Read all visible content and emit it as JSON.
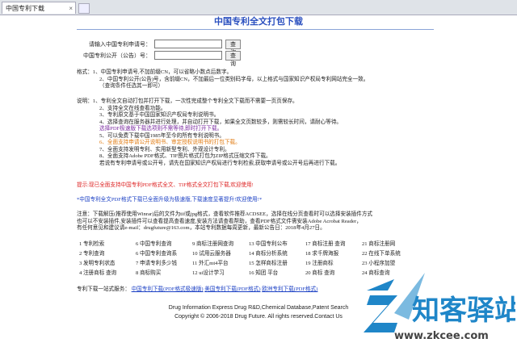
{
  "tab": {
    "label": "中国专利下载"
  },
  "title": "中国专利全文打包下载",
  "form": {
    "app_label": "请输入中国专利申请号：",
    "pub_label": "中国专利公开（公告）号：",
    "query_label": "查询",
    "query_label2": "查询"
  },
  "format_lines": [
    "格式：1、中国专利申请号,不加前缀CN，可以省略小数点后数字。",
    "2、中国专利公开(公告)号，含前缀CN，不加最后一位类别码字母，以上格式与国家知识产权局专利网站完全一致。",
    "（查询条件任选其一即可）"
  ],
  "notes_head": "说明：1、专利全文自动打包并打开下载，一次性完成整个专利全文下载而不需要一页页保存。",
  "notes": [
    {
      "text": "2、支持全文在线查看功能。",
      "color": ""
    },
    {
      "text": "3、专利原文基于中国国家知识产权局专利说明书。",
      "color": ""
    },
    {
      "text": "4、选择查询在服务器并进行处理，并自动打开下载，如果全文页数较多，则需较长时间，请耐心等待。",
      "color": ""
    },
    {
      "text": "选择PDF极速版下载选项则不需等待,即时打开下载。",
      "color": "purple"
    },
    {
      "text": "5、可以免费下载中国1985年至今的所有专利说明书。",
      "color": ""
    },
    {
      "text": "6、全面支持申请公开说明书、审定授权说明书的打包下载。",
      "color": "orange"
    },
    {
      "text": "7、全面支持发明专利、实用新型专利、外观设计专利。",
      "color": ""
    },
    {
      "text": "8、全面支持Adobe PDF格式、TIF图片格式打包为ZIP格式压缩文件下载。",
      "color": ""
    },
    {
      "text": "若说有专利申请号或公开号，请先在国家知识产权局进行专利检索,获取申请号或公开号后再进行下载。",
      "color": ""
    }
  ],
  "notice_red": "提示:现已全面支持中国专利PDF格式全文、TIF格式全文打包下载,欢迎使用!",
  "notice_blue": "*中国专利全文PDF格式下载已全面升级为极速版,下载速度显著提升!欢迎使用!*",
  "attention": [
    "注意：下载解压(推荐使用Winrar)后的文件为tif或jpg格式，查看软件推荐ACDSEE，选择在线分页查看时可以选择安装插件方式",
    "也可以不安装插件,安装插件可以查看提高查看速度,安装方法请查看帮助，查看PDF格式文件需安装Adobe Acrobat Reader，",
    "有任何意见和建议请e-mail：drugfuture@163.com，本站专利数据每周更新，最新公告日：2018年4月27日。"
  ],
  "services": [
    [
      "1 专利检索",
      "6 中国专利查询",
      "9 商标注册网查询",
      "13 中国专利公布",
      "17 商标注册 查询",
      "21 商标注册网"
    ],
    [
      "2 专利查询",
      "6 中国专利查询系",
      "10 试用云服务器",
      "14 商标分析系统",
      "18 求千牌海报",
      "22 在线下单系统"
    ],
    [
      "3 发明专利状态",
      "7 申请专利多少钱",
      "11 外汇mt4平台",
      "15 怎样商标注册",
      "19 注册商标",
      "23 小程序加盟"
    ],
    [
      "4 注册商标 查询",
      "8 商标购买",
      "12 ui设计学习",
      "16 知团 平台",
      "20 商标 查询",
      "24 商标查询"
    ]
  ],
  "onestop_prefix": "专利下载一站式服务：",
  "onestop_links": [
    "中国专利下载(PDF格式极速版)",
    "美国专利下载(PDF格式)",
    "欧洲专利下载(PDF格式)"
  ],
  "footer1": "Drug Information Express  Drug R&D,Chemical Database,Patent Search",
  "footer2": "Copyright © 2006-2018 Drug Future. All rights reserved.Contact Us",
  "watermark": {
    "name": "知客驿站",
    "url": "www.zkcee.com",
    "brand_color": "#1f86c8"
  },
  "colors": {
    "title": "#2a4fbf",
    "red": "#d22222",
    "blue": "#1a3fc4"
  }
}
